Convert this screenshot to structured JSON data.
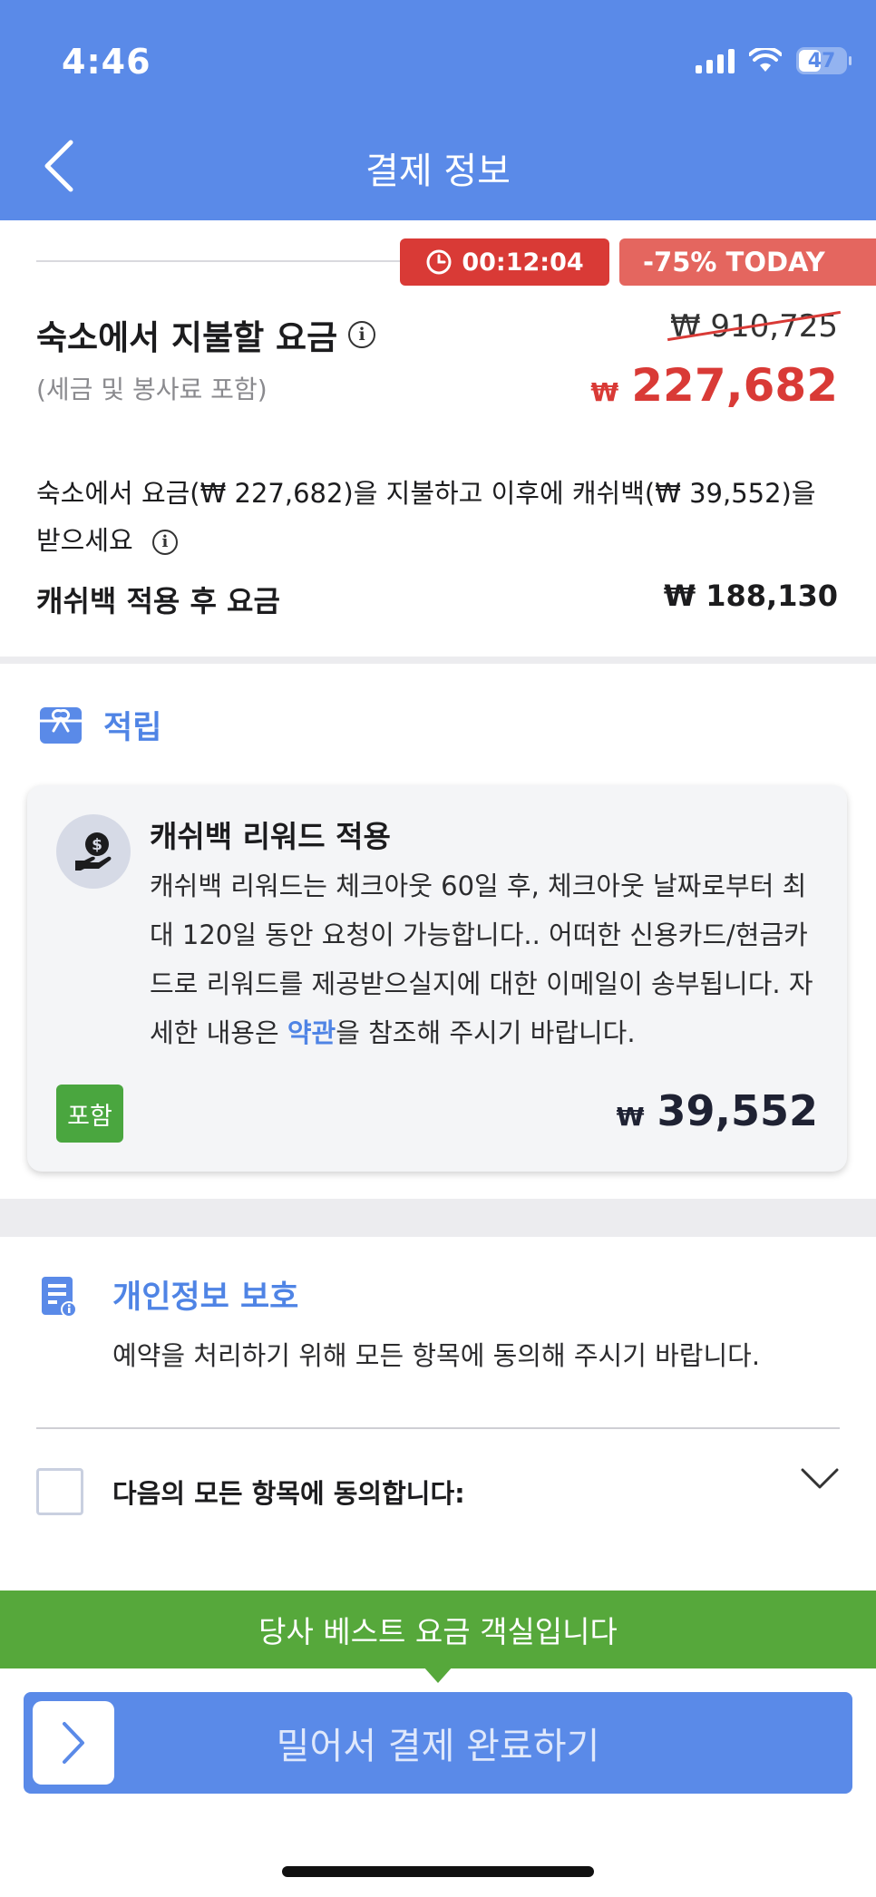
{
  "status_bar": {
    "time": "4:46",
    "battery": "47"
  },
  "header": {
    "title": "결제 정보"
  },
  "timer": {
    "value": "00:12:04"
  },
  "discount": {
    "label": "-75% TODAY"
  },
  "pay_at_property": {
    "title": "숙소에서 지불할 요금",
    "subtitle": "(세금 및 봉사료 포함)",
    "original_price": "₩ 910,725",
    "currency": "₩",
    "final_price": "227,682"
  },
  "cashback": {
    "description": "숙소에서 요금(₩ 227,682)을 지불하고 이후에 캐쉬백(₩ 39,552)을 받으세요",
    "after_label": "캐쉬백 적용 후 요금",
    "after_value": "₩ 188,130"
  },
  "earn": {
    "title": "적립",
    "card": {
      "title": "캐쉬백 리워드 적용",
      "text_before": "캐쉬백 리워드는 체크아웃 60일 후, 체크아웃 날짜로부터 최대 120일 동안 요청이 가능합니다.. 어떠한 신용카드/현금카드로 리워드를 제공받으실지에 대한 이메일이 송부됩니다. 자세한 내용은 ",
      "link": "약관",
      "text_after": "을 참조해 주시기 바랍니다.",
      "badge": "포함",
      "currency": "₩",
      "amount": "39,552"
    }
  },
  "privacy": {
    "title": "개인정보 보호",
    "description": "예약을 처리하기 위해 모든 항목에 동의해 주시기 바랍니다.",
    "agree_all_label": "다음의 모든 항목에 동의합니다:"
  },
  "best_banner": "당사 베스트 요금 객실입니다",
  "slide_button": "밀어서 결제 완료하기",
  "colors": {
    "accent": "#5a8ae8",
    "price_red": "#d93a36",
    "green": "#56a83b"
  },
  "icons": [
    "back-chevron-icon",
    "signal-icon",
    "wifi-icon",
    "battery-icon",
    "clock-icon",
    "info-icon",
    "gift-icon",
    "cash-hand-icon",
    "privacy-document-icon",
    "chevron-down-icon",
    "chevron-right-icon"
  ]
}
